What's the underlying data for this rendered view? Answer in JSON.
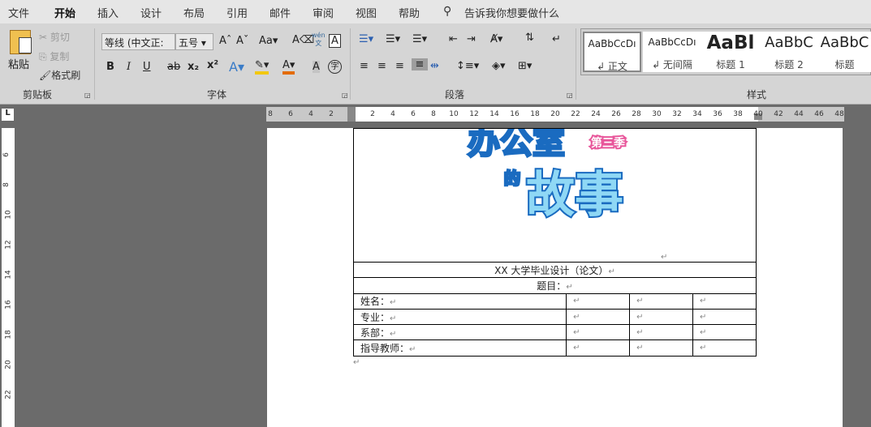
{
  "menu": {
    "items": [
      "文件",
      "开始",
      "插入",
      "设计",
      "布局",
      "引用",
      "邮件",
      "审阅",
      "视图",
      "帮助"
    ],
    "active": "开始",
    "search_placeholder": "告诉我你想要做什么"
  },
  "clipboard": {
    "paste": "粘贴",
    "cut": "剪切",
    "copy": "复制",
    "format_painter": "格式刷",
    "group": "剪贴板"
  },
  "font": {
    "name": "等线 (中文正文)",
    "display_name": "等线 (中文正:",
    "size": "五号",
    "group": "字体",
    "bold": "B",
    "italic": "I",
    "underline": "U",
    "change_case": "Aa",
    "phonetic": "wén",
    "enclose": "字"
  },
  "paragraph": {
    "group": "段落"
  },
  "styles": {
    "group": "样式",
    "items": [
      {
        "sample": "AaBbCcDı",
        "name": "↲ 正文"
      },
      {
        "sample": "AaBbCcDı",
        "name": "↲ 无间隔"
      },
      {
        "sample": "AaBl",
        "name": "标题 1"
      },
      {
        "sample": "AaBbC",
        "name": "标题 2"
      },
      {
        "sample": "AaBbC",
        "name": "标题"
      }
    ]
  },
  "ruler": {
    "left": [
      "8",
      "6",
      "4",
      "2"
    ],
    "right": [
      "2",
      "4",
      "6",
      "8",
      "10",
      "12",
      "14",
      "16",
      "18",
      "20",
      "22",
      "24",
      "26",
      "28",
      "30",
      "32",
      "34",
      "36",
      "38",
      "40",
      "42",
      "44",
      "46",
      "48"
    ],
    "vertical": [
      "6",
      "8",
      "10",
      "12",
      "14",
      "16",
      "18",
      "20",
      "22"
    ]
  },
  "document": {
    "logo_text": "办公室的故事 第三季",
    "table": {
      "title": "XX 大学毕业设计（论文）",
      "subject": "题目：",
      "rows": [
        "姓名：",
        "专业：",
        "系部：",
        "指导教师："
      ]
    },
    "para_mark": "↵"
  },
  "colors": {
    "highlight": "#f2c811",
    "font_color": "#e36c09",
    "ribbon": "#d5d5d5",
    "workspace": "#6b6b6b"
  }
}
